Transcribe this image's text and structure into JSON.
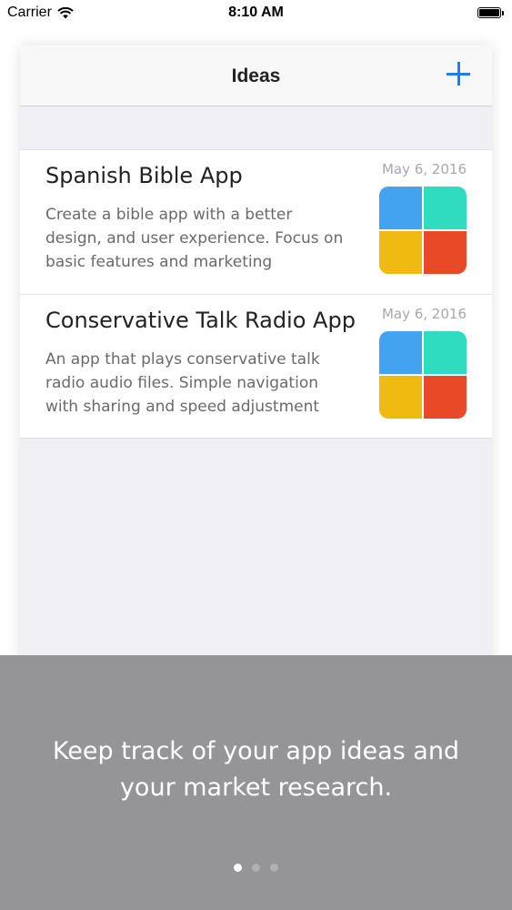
{
  "status_bar": {
    "carrier": "Carrier",
    "time": "8:10 AM"
  },
  "nav": {
    "title": "Ideas",
    "add_icon": "plus-icon"
  },
  "ideas": [
    {
      "title": "Spanish Bible App",
      "description": "Create a bible app with a better design, and user experience. Focus on basic features and marketing",
      "date": "May 6, 2016"
    },
    {
      "title": "Conservative Talk Radio App",
      "description": "An app that plays conservative talk radio audio files. Simple navigation with sharing and speed adjustment",
      "date": "May 6, 2016"
    }
  ],
  "onboarding": {
    "message": "Keep track of your app ideas and your market research.",
    "page_count": 3,
    "active_page": 1
  },
  "colors": {
    "accent": "#1e7ef0",
    "overlay": "#959497",
    "tile_blue": "#44a3f0",
    "tile_teal": "#2fdcc0",
    "tile_yellow": "#f0bb10",
    "tile_red": "#e84a28"
  }
}
